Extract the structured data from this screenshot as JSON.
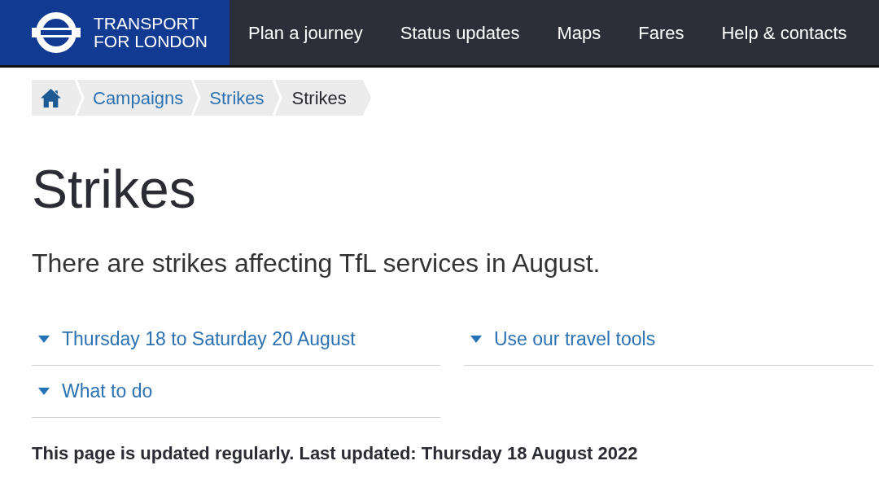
{
  "header": {
    "logo": {
      "lines": [
        "TRANSPORT",
        "FOR LONDON"
      ]
    },
    "nav": [
      "Plan a journey",
      "Status updates",
      "Maps",
      "Fares",
      "Help & contacts"
    ]
  },
  "breadcrumbs": [
    {
      "kind": "home"
    },
    {
      "kind": "link",
      "label": "Campaigns"
    },
    {
      "kind": "link",
      "label": "Strikes"
    },
    {
      "kind": "current",
      "label": "Strikes"
    }
  ],
  "page": {
    "title": "Strikes",
    "intro": "There are strikes affecting TfL services in August."
  },
  "accordions": {
    "columns": [
      [
        {
          "label": "Thursday 18 to Saturday 20 August",
          "expanded": false
        },
        {
          "label": "What to do",
          "expanded": false
        }
      ],
      [
        {
          "label": "Use our travel tools",
          "expanded": false
        }
      ]
    ]
  },
  "footer_note": "This page is updated regularly. Last updated: Thursday 18 August 2022"
}
